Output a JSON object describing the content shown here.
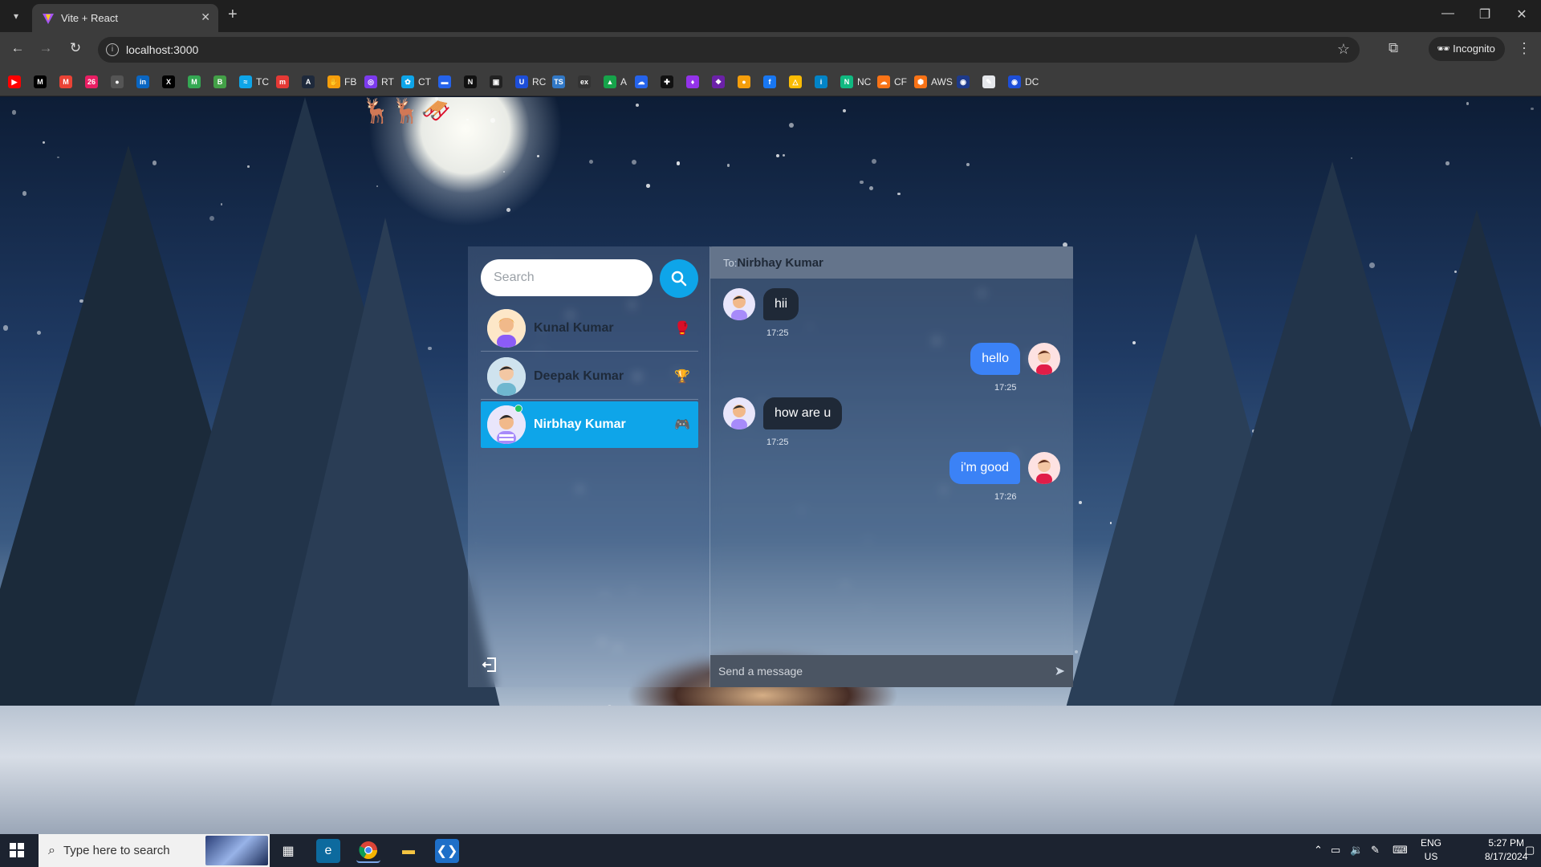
{
  "browser": {
    "tab_title": "Vite + React",
    "url": "localhost:3000",
    "incognito_label": "Incognito",
    "bookmarks": [
      {
        "icon": "youtube-icon",
        "label": "",
        "color": "#ff0000",
        "glyph": "▶"
      },
      {
        "icon": "medium-icon",
        "label": "",
        "color": "#000000",
        "glyph": "M"
      },
      {
        "icon": "gmail-icon",
        "label": "",
        "color": "#ea4335",
        "glyph": "M"
      },
      {
        "icon": "calendar-icon",
        "label": "",
        "color": "#e91e63",
        "glyph": "26"
      },
      {
        "icon": "github-icon",
        "label": "",
        "color": "#555555",
        "glyph": "●"
      },
      {
        "icon": "linkedin-icon",
        "label": "",
        "color": "#0a66c2",
        "glyph": "in"
      },
      {
        "icon": "x-icon",
        "label": "",
        "color": "#000000",
        "glyph": "X"
      },
      {
        "icon": "gmail-icon-2",
        "label": "",
        "color": "#34a853",
        "glyph": "M"
      },
      {
        "icon": "b-icon",
        "label": "",
        "color": "#43a047",
        "glyph": "B"
      },
      {
        "icon": "tc-icon",
        "label": "TC",
        "color": "#0ea5e9",
        "glyph": "≈"
      },
      {
        "icon": "red-icon",
        "label": "",
        "color": "#e53935",
        "glyph": "m"
      },
      {
        "icon": "a-icon",
        "label": "",
        "color": "#1e293b",
        "glyph": "A"
      },
      {
        "icon": "fb-hand-icon",
        "label": "FB",
        "color": "#f59e0b",
        "glyph": "✋"
      },
      {
        "icon": "rt-icon",
        "label": "RT",
        "color": "#7c3aed",
        "glyph": "◎"
      },
      {
        "icon": "ct-icon",
        "label": "CT",
        "color": "#0ea5e9",
        "glyph": "✿"
      },
      {
        "icon": "flag-icon",
        "label": "",
        "color": "#2563eb",
        "glyph": "▬"
      },
      {
        "icon": "n-icon",
        "label": "",
        "color": "#111111",
        "glyph": "N"
      },
      {
        "icon": "briefcase-icon",
        "label": "",
        "color": "#222222",
        "glyph": "▣"
      },
      {
        "icon": "rc-icon",
        "label": "RC",
        "color": "#1d4ed8",
        "glyph": "U"
      },
      {
        "icon": "ts-icon",
        "label": "",
        "color": "#3178c6",
        "glyph": "TS"
      },
      {
        "icon": "ex-icon",
        "label": "",
        "color": "#333333",
        "glyph": "ex"
      },
      {
        "icon": "a-leaf-icon",
        "label": "A",
        "color": "#16a34a",
        "glyph": "▲"
      },
      {
        "icon": "cloud-icon",
        "label": "",
        "color": "#2563eb",
        "glyph": "☁"
      },
      {
        "icon": "puzzle-icon",
        "label": "",
        "color": "#111111",
        "glyph": "✚"
      },
      {
        "icon": "mic-icon",
        "label": "",
        "color": "#9333ea",
        "glyph": "♦"
      },
      {
        "icon": "octo-icon",
        "label": "",
        "color": "#6b21a8",
        "glyph": "❖"
      },
      {
        "icon": "person-icon",
        "label": "",
        "color": "#f59e0b",
        "glyph": "●"
      },
      {
        "icon": "facebook-icon",
        "label": "",
        "color": "#1877f2",
        "glyph": "f"
      },
      {
        "icon": "drive-icon",
        "label": "",
        "color": "#fbbc04",
        "glyph": "△"
      },
      {
        "icon": "info-icon",
        "label": "",
        "color": "#0284c7",
        "glyph": "i"
      },
      {
        "icon": "nc-icon",
        "label": "NC",
        "color": "#10b981",
        "glyph": "N"
      },
      {
        "icon": "cf-icon",
        "label": "CF",
        "color": "#f97316",
        "glyph": "☁"
      },
      {
        "icon": "aws-icon",
        "label": "AWS",
        "color": "#f97316",
        "glyph": "⬢"
      },
      {
        "icon": "bug-icon",
        "label": "",
        "color": "#1e3a8a",
        "glyph": "◉"
      },
      {
        "icon": "pen-icon",
        "label": "",
        "color": "#e5e7eb",
        "glyph": "✎"
      },
      {
        "icon": "dc-icon",
        "label": "DC",
        "color": "#1d4ed8",
        "glyph": "◉"
      }
    ]
  },
  "app": {
    "search": {
      "placeholder": "Search"
    },
    "contacts": [
      {
        "name": "Kunal Kumar",
        "emoji": "🥊",
        "online": false,
        "active": false,
        "avatar": "female-avatar"
      },
      {
        "name": "Deepak Kumar",
        "emoji": "🏆",
        "online": false,
        "active": false,
        "avatar": "male-avatar"
      },
      {
        "name": "Nirbhay Kumar",
        "emoji": "🎮",
        "online": true,
        "active": true,
        "avatar": "male-avatar-2"
      }
    ],
    "chat": {
      "to_label": "To:",
      "recipient": "Nirbhay Kumar",
      "messages": [
        {
          "direction": "in",
          "text": "hii",
          "time": "17:25"
        },
        {
          "direction": "out",
          "text": "hello",
          "time": "17:25"
        },
        {
          "direction": "in",
          "text": "how are u",
          "time": "17:25"
        },
        {
          "direction": "out",
          "text": "i'm good",
          "time": "17:26"
        }
      ],
      "composer_placeholder": "Send a message"
    }
  },
  "taskbar": {
    "search_placeholder": "Type here to search",
    "lang_line1": "ENG",
    "lang_line2": "US",
    "time": "5:27 PM",
    "date": "8/17/2024"
  },
  "colors": {
    "accent": "#0ea5e9",
    "outgoing_bubble": "#3b82f6",
    "incoming_bubble": "#1f2937",
    "chat_header": "#64748b",
    "online": "#22c55e"
  }
}
